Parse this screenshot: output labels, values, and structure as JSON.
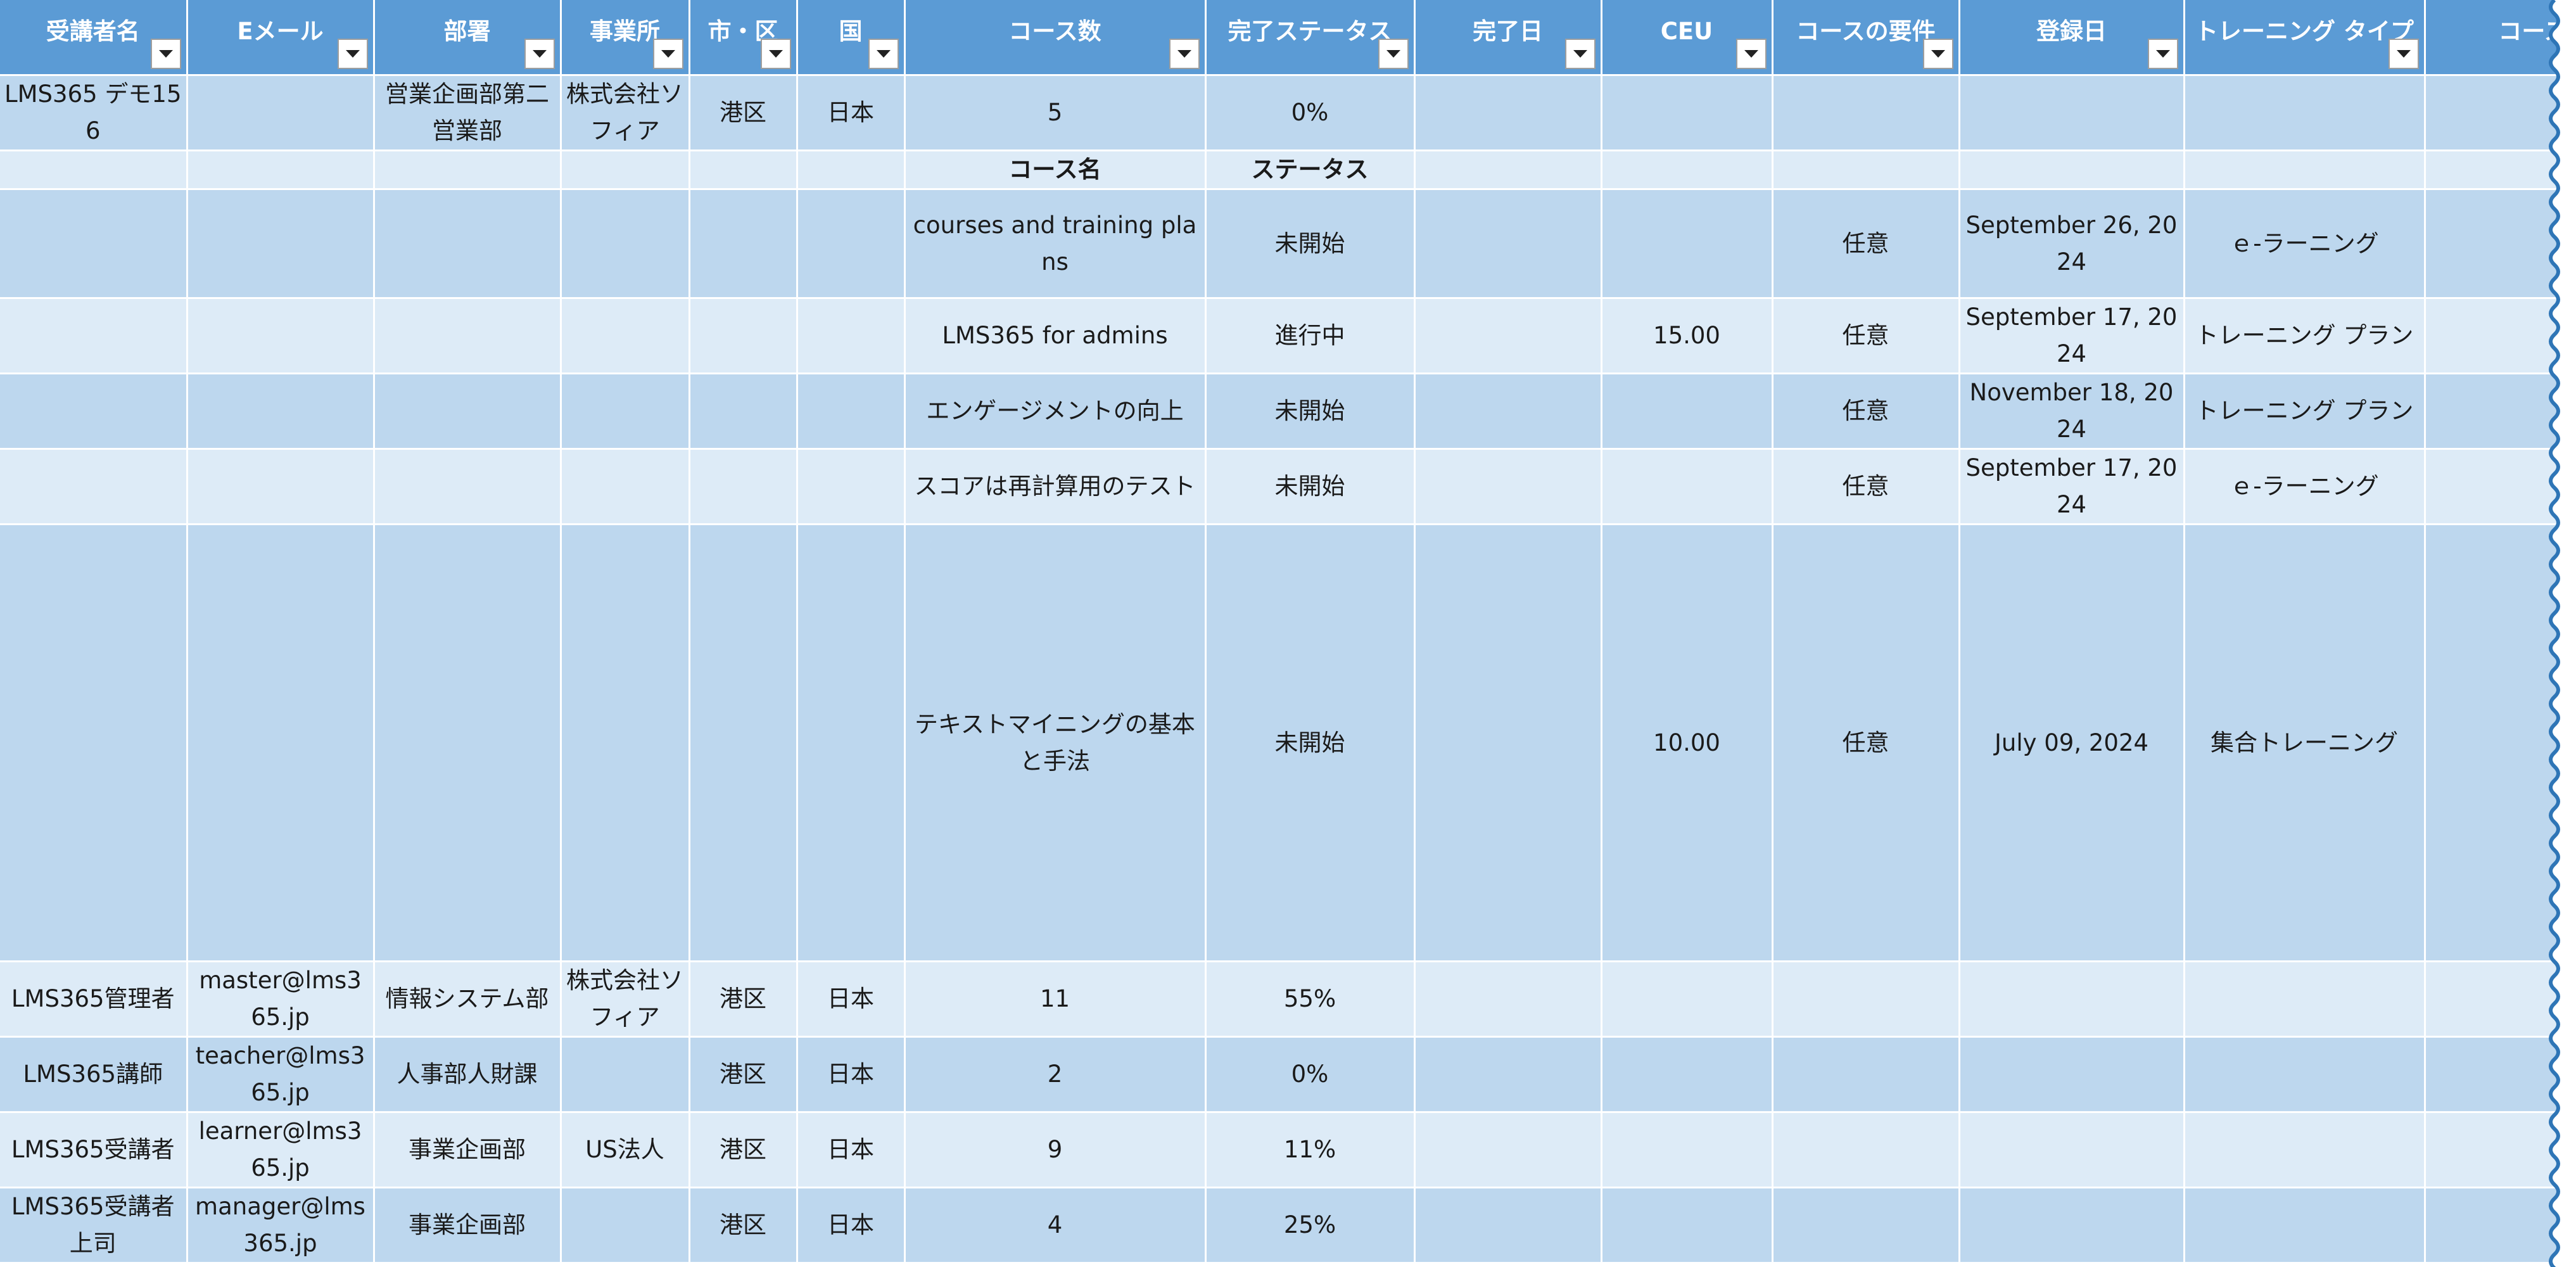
{
  "headers": [
    "受講者名",
    "Eメール",
    "部署",
    "事業所",
    "市・区",
    "国",
    "コース数",
    "完了ステータス",
    "完了日",
    "CEU",
    "コースの要件",
    "登録日",
    "トレーニング タイプ",
    "コース"
  ],
  "learner1": {
    "name": "LMS365 デモ156",
    "email": "",
    "dept": "営業企画部第二営業部",
    "office": "株式会社ソフィア",
    "city": "港区",
    "country": "日本",
    "courses": "5",
    "status": "0%"
  },
  "sub_header": {
    "course_name": "コース名",
    "status": "ステータス"
  },
  "courses": [
    {
      "name": "courses and training plans",
      "status": "未開始",
      "date": "",
      "ceu": "",
      "req": "任意",
      "registered": "September 26, 2024",
      "type": "ｅ-ラーニング"
    },
    {
      "name": "LMS365 for admins",
      "status": "進行中",
      "date": "",
      "ceu": "15.00",
      "req": "任意",
      "registered": "September 17, 2024",
      "type": "トレーニング プラン"
    },
    {
      "name": "エンゲージメントの向上",
      "status": "未開始",
      "date": "",
      "ceu": "",
      "req": "任意",
      "registered": "November 18, 2024",
      "type": "トレーニング プラン"
    },
    {
      "name": "スコアは再計算用のテスト",
      "status": "未開始",
      "date": "",
      "ceu": "",
      "req": "任意",
      "registered": "September 17, 2024",
      "type": "ｅ-ラーニング"
    },
    {
      "name": "テキストマイニングの基本と手法",
      "status": "未開始",
      "date": "",
      "ceu": "10.00",
      "req": "任意",
      "registered": "July 09, 2024",
      "type": "集合トレーニング"
    }
  ],
  "learners": [
    {
      "name": "LMS365管理者",
      "email": "master@lms365.jp",
      "dept": "情報システム部",
      "office": "株式会社ソフィア",
      "city": "港区",
      "country": "日本",
      "courses": "11",
      "status": "55%"
    },
    {
      "name": "LMS365講師",
      "email": "teacher@lms365.jp",
      "dept": "人事部人財課",
      "office": "",
      "city": "港区",
      "country": "日本",
      "courses": "2",
      "status": "0%"
    },
    {
      "name": "LMS365受講者",
      "email": "learner@lms365.jp",
      "dept": "事業企画部",
      "office": "US法人",
      "city": "港区",
      "country": "日本",
      "courses": "9",
      "status": "11%"
    },
    {
      "name": "LMS365受講者上司",
      "email": "manager@lms365.jp",
      "dept": "事業企画部",
      "office": "",
      "city": "港区",
      "country": "日本",
      "courses": "4",
      "status": "25%"
    }
  ]
}
